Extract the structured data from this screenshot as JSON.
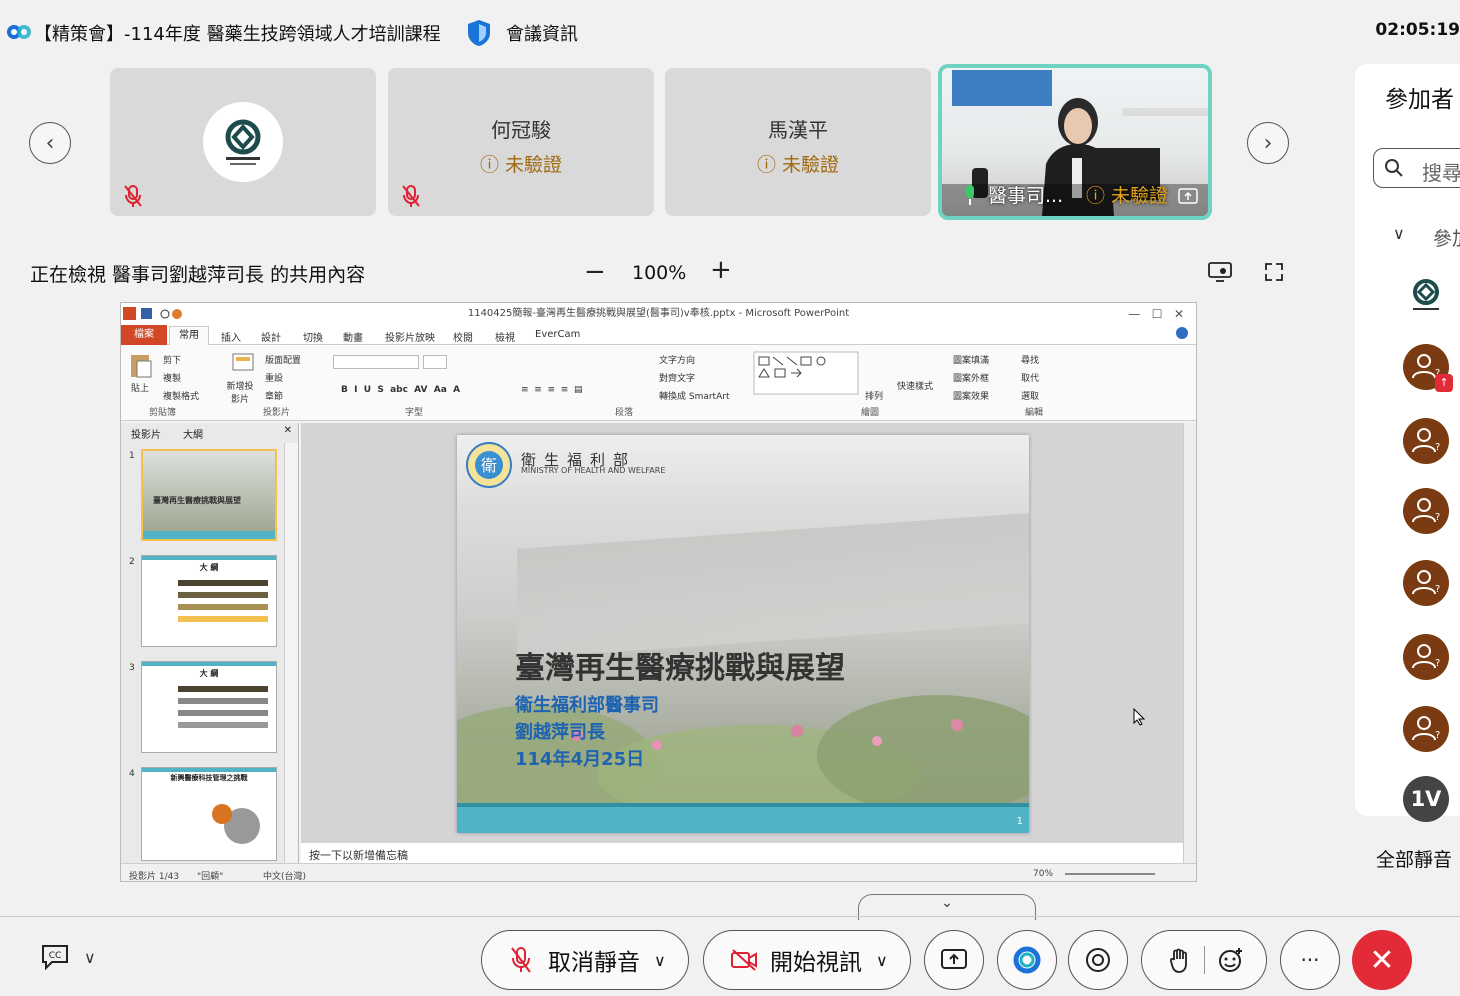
{
  "topbar": {
    "title": "【精策會】-114年度 醫藥生技跨領域人才培訓課程",
    "info": "會議資訊",
    "clock": "02:05:19"
  },
  "tiles": [
    {
      "name": "",
      "status": ""
    },
    {
      "name": "何冠駿",
      "status": "未驗證"
    },
    {
      "name": "馬漢平",
      "status": "未驗證"
    },
    {
      "name": "醫事司...",
      "status": "未驗證"
    }
  ],
  "share": {
    "viewing": "正在檢視 醫事司劉越萍司長 的共用內容",
    "zoom_minus": "−",
    "zoom": "100%",
    "zoom_plus": "+"
  },
  "ppt": {
    "window_title": "1140425簡報-臺灣再生醫療挑戰與展望(醫事司)v奉核.pptx - Microsoft PowerPoint",
    "tabs": [
      "檔案",
      "常用",
      "插入",
      "設計",
      "切換",
      "動畫",
      "投影片放映",
      "校閱",
      "檢視",
      "EverCam"
    ],
    "groups": [
      "剪貼簿",
      "投影片",
      "字型",
      "段落",
      "繪圖",
      "編輯"
    ],
    "ribbon_items": [
      "剪下",
      "複製",
      "複製格式",
      "貼上",
      "新增投影片",
      "版面配置",
      "重設",
      "章節",
      "文字方向",
      "對齊文字",
      "轉換成 SmartArt",
      "排列",
      "快速樣式",
      "圖案填滿",
      "圖案外框",
      "圖案效果",
      "尋找",
      "取代",
      "選取"
    ],
    "panel_tabs": [
      "投影片",
      "大綱"
    ],
    "thumbs": [
      {
        "n": "1",
        "title": "臺灣再生醫療挑戰與展望"
      },
      {
        "n": "2",
        "title": "大 綱"
      },
      {
        "n": "3",
        "title": "大 綱"
      },
      {
        "n": "4",
        "title": "新興醫療科技管理之挑戰"
      }
    ],
    "slide": {
      "ministry": "衛生福利部",
      "ministry_en": "MINISTRY OF HEALTH AND WELFARE",
      "title": "臺灣再生醫療挑戰與展望",
      "line1": "衛生福利部醫事司",
      "line2": "劉越萍司長",
      "line3": "114年4月25日",
      "page": "1"
    },
    "notes": "按一下以新增備忘稿",
    "status_left": "投影片 1/43",
    "status_theme": "\"回顧\"",
    "status_lang": "中文(台灣)",
    "status_zoom": "70%"
  },
  "side": {
    "title": "參加者",
    "search_placeholder": "搜尋",
    "group": "參加者",
    "last_avatar": "1V",
    "mute_all": "全部靜音"
  },
  "bottom": {
    "mute": "取消靜音",
    "video": "開始視訊"
  },
  "colors": {
    "leave": "#e22b36",
    "accent": "#6fd3c2",
    "avatar": "#7a3a12",
    "unverified": "#a06a10"
  }
}
